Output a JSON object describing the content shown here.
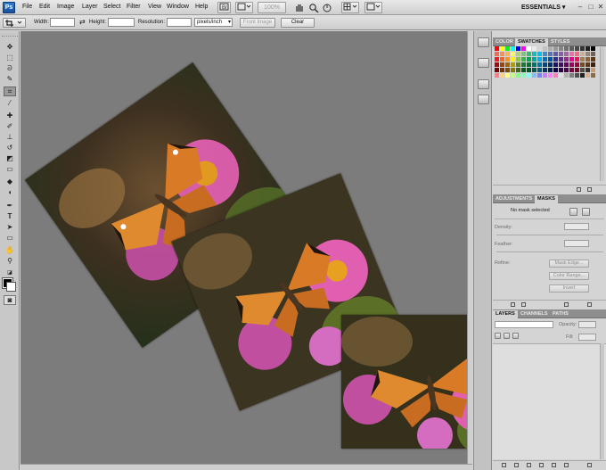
{
  "menubar": {
    "logo": "Ps",
    "items": [
      "File",
      "Edit",
      "Image",
      "Layer",
      "Select",
      "Filter",
      "View",
      "Window",
      "Help"
    ],
    "zoom_value": "100%",
    "workspace": "ESSENTIALS",
    "window_controls": [
      "–",
      "□",
      "✕"
    ]
  },
  "options": {
    "width_label": "Width:",
    "width_value": "",
    "height_label": "Height:",
    "height_value": "",
    "resolution_label": "Resolution:",
    "resolution_value": "",
    "resolution_unit": "pixels/inch",
    "front_image_label": "Front Image",
    "clear_label": "Clear"
  },
  "tools": [
    "move-tool",
    "marquee-tool",
    "lasso-tool",
    "quick-selection-tool",
    "crop-tool",
    "eyedropper-tool",
    "spot-healing-tool",
    "brush-tool",
    "clone-stamp-tool",
    "history-brush-tool",
    "eraser-tool",
    "gradient-tool",
    "blur-tool",
    "dodge-tool",
    "pen-tool",
    "type-tool",
    "path-selection-tool",
    "shape-tool",
    "hand-tool",
    "zoom-tool"
  ],
  "panels": {
    "color_tabs": {
      "color": "COLOR",
      "swatches": "SWATCHES",
      "styles": "STYLES"
    },
    "swatch_colors": [
      "#ff0000",
      "#ffff00",
      "#00ff00",
      "#00ffff",
      "#0000ff",
      "#ff00ff",
      "#ffffff",
      "#ebebeb",
      "#d6d6d6",
      "#c2c2c2",
      "#adadad",
      "#999999",
      "#858585",
      "#707070",
      "#5c5c5c",
      "#474747",
      "#333333",
      "#1f1f1f",
      "#000000",
      "#f26c4f",
      "#f68e55",
      "#fbaf5c",
      "#fff467",
      "#acd372",
      "#7cc576",
      "#3bb878",
      "#1abbb4",
      "#00bff3",
      "#438ccb",
      "#5574b9",
      "#605ca8",
      "#855fa8",
      "#a763a8",
      "#f06eaa",
      "#f26d7d",
      "#c7b299",
      "#998675",
      "#736357",
      "#ed1c24",
      "#f26522",
      "#f7941d",
      "#fff200",
      "#8dc63f",
      "#39b54a",
      "#00a651",
      "#00a99d",
      "#00aeef",
      "#0072bc",
      "#0054a6",
      "#2e3192",
      "#662d91",
      "#92278f",
      "#ec008c",
      "#ed145b",
      "#a67c52",
      "#8c6239",
      "#603913",
      "#9e0b0f",
      "#a0410d",
      "#a36209",
      "#aba000",
      "#598527",
      "#197b30",
      "#007236",
      "#00746b",
      "#0076a3",
      "#004a80",
      "#003471",
      "#1b1464",
      "#440e62",
      "#630460",
      "#9e005d",
      "#9e0039",
      "#754c24",
      "#603813",
      "#42210b",
      "#790000",
      "#7b2e00",
      "#7d4900",
      "#827b00",
      "#406618",
      "#005e20",
      "#005826",
      "#005952",
      "#005b7f",
      "#003663",
      "#002157",
      "#0d004c",
      "#32004b",
      "#4b0049",
      "#7b0046",
      "#7a0026",
      "#534741",
      "#362f2d",
      "#c69c6d",
      "#ff8080",
      "#ffd280",
      "#ffff80",
      "#c0ff80",
      "#80ff80",
      "#80ffc0",
      "#80ffff",
      "#80c0ff",
      "#8080ff",
      "#c080ff",
      "#ff80ff",
      "#ff80c0",
      "#e0e0e0",
      "#b0b0b0",
      "#808080",
      "#505050",
      "#202020",
      "#d9b38c",
      "#8c6d46"
    ],
    "masks_tabs": {
      "adjustments": "ADJUSTMENTS",
      "masks": "MASKS"
    },
    "masks": {
      "status": "No mask selected",
      "density_label": "Density:",
      "feather_label": "Feather:",
      "refine_label": "Refine:",
      "mask_edge_label": "Mask Edge...",
      "color_range_label": "Color Range...",
      "invert_label": "Invert"
    },
    "layers_tabs": {
      "layers": "LAYERS",
      "channels": "CHANNELS",
      "paths": "PATHS"
    },
    "layers": {
      "blend_mode": "",
      "opacity_label": "Opacity:",
      "fill_label": "Fill:"
    }
  }
}
